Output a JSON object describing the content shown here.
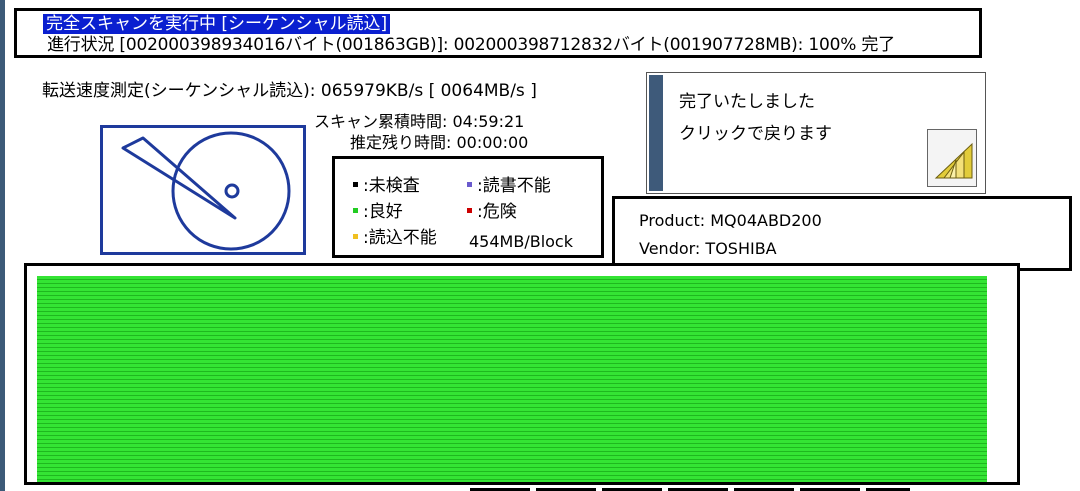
{
  "status": {
    "title": "完全スキャンを実行中 [シーケンシャル読込]",
    "progress_text": "進行状況 [002000398934016バイト(001863GB)]: 002000398712832バイト(001907728MB): 100% 完了"
  },
  "speed": {
    "text": "転送速度測定(シーケンシャル読込): 065979KB/s [ 0064MB/s ]"
  },
  "times": {
    "elapsed_label": "スキャン累積時間:",
    "elapsed_value": "04:59:21",
    "remaining_label": "推定残り時間:",
    "remaining_value": "00:00:00"
  },
  "legend": {
    "items": [
      {
        "label": ":未検査",
        "color": "#000000"
      },
      {
        "label": ":読書不能",
        "color": "#6a5acd"
      },
      {
        "label": ":良好",
        "color": "#22cc22"
      },
      {
        "label": ":危険",
        "color": "#cc0000"
      },
      {
        "label": ":読込不能",
        "color": "#f0c020"
      }
    ],
    "block_size": "454MB/Block"
  },
  "done_panel": {
    "line1": "完了いたしました",
    "line2": "クリックで戻ります",
    "icon": "back-arrow-icon"
  },
  "device": {
    "product_label": "Product:",
    "product_value": "MQ04ABD200",
    "vendor_label": "Vendor:",
    "vendor_value": "TOSHIBA"
  },
  "block_map": {
    "status": "all-good",
    "fill_color": "#2fe02f",
    "progress_percent": 100
  },
  "colors": {
    "title_highlight": "#0a1fd0",
    "disk_stroke": "#1e3a9c",
    "panel_stripe": "#3e5a7a"
  }
}
